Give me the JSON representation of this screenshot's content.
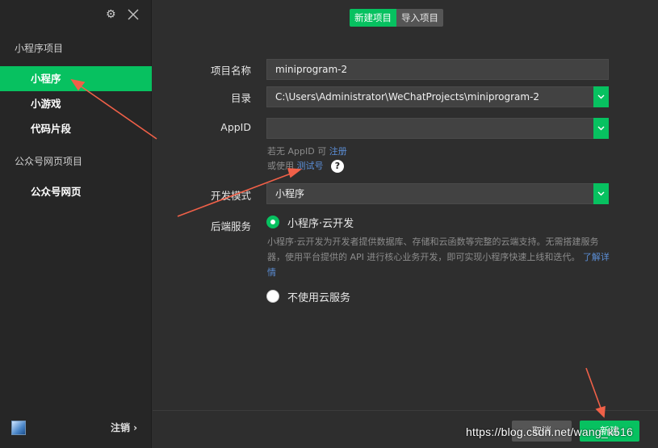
{
  "sidebar": {
    "section1_title": "小程序项目",
    "items1": [
      {
        "label": "小程序"
      },
      {
        "label": "小游戏"
      },
      {
        "label": "代码片段"
      }
    ],
    "section2_title": "公众号网页项目",
    "items2": [
      {
        "label": "公众号网页"
      }
    ],
    "logout_label": "注销 ›"
  },
  "tabs": [
    {
      "label": "新建项目",
      "active": true
    },
    {
      "label": "导入项目",
      "active": false
    }
  ],
  "form": {
    "name_label": "项目名称",
    "name_value": "miniprogram-2",
    "dir_label": "目录",
    "dir_value": "C:\\Users\\Administrator\\WeChatProjects\\miniprogram-2",
    "appid_label": "AppID",
    "appid_value": "",
    "hint1_text": "若无 AppID 可",
    "hint1_link": "注册",
    "hint2_text": "或使用",
    "hint2_link": "测试号",
    "help_icon": "?",
    "mode_label": "开发模式",
    "mode_value": "小程序",
    "backend_label": "后端服务",
    "backend_option1": "小程序·云开发",
    "backend_desc": "小程序·云开发为开发者提供数据库、存储和云函数等完整的云端支持。无需搭建服务器，使用平台提供的 API 进行核心业务开发，即可实现小程序快速上线和迭代。",
    "backend_desc_link": "了解详情",
    "backend_option2": "不使用云服务",
    "backend_selected": "小程序·云开发"
  },
  "footer": {
    "cancel_label": "取消",
    "create_label": "新建"
  },
  "watermark": "https://blog.csdn.net/wang_k516",
  "colors": {
    "accent": "#07c160",
    "annotation_arrow": "#f06048"
  }
}
